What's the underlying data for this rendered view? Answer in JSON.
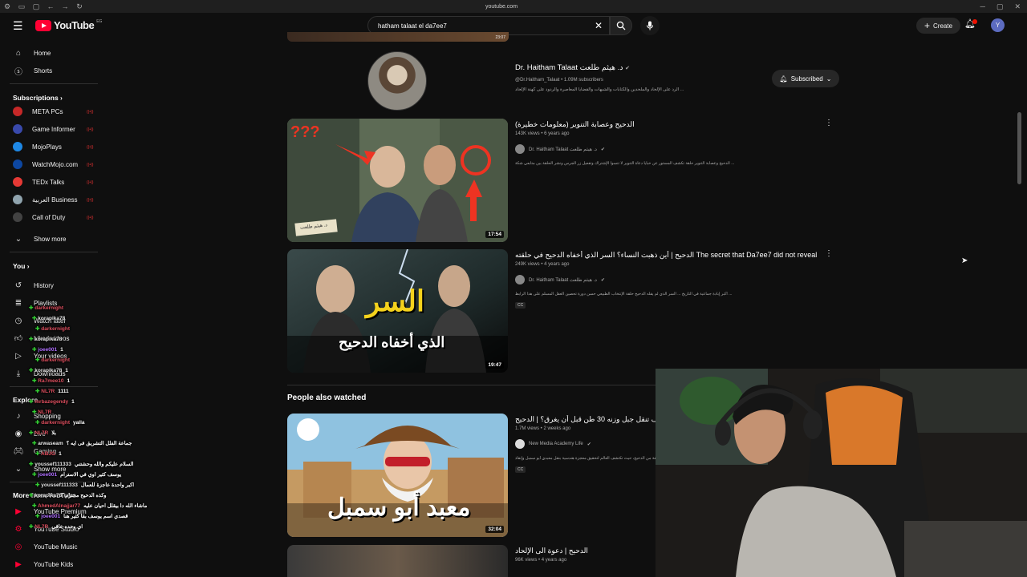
{
  "browser": {
    "url": "youtube.com"
  },
  "masthead": {
    "logo_text": "YouTube",
    "region": "EG",
    "search_query": "hatham talaat el da7ee7",
    "create_label": "Create",
    "avatar_letter": "Y",
    "bell_badge": "9+"
  },
  "sidebar": {
    "home": "Home",
    "shorts": "Shorts",
    "subscriptions_header": "Subscriptions",
    "subscriptions": [
      {
        "label": "META PCs",
        "color": "#c62828"
      },
      {
        "label": "Game Informer",
        "color": "#3949ab"
      },
      {
        "label": "MojoPlays",
        "color": "#1e88e5"
      },
      {
        "label": "WatchMojo.com",
        "color": "#0d47a1"
      },
      {
        "label": "TEDx Talks",
        "color": "#e53935"
      },
      {
        "label": "العربية Business",
        "color": "#90a4ae"
      },
      {
        "label": "Call of Duty",
        "color": "#424242"
      }
    ],
    "show_more": "Show more",
    "you_header": "You",
    "you_items": [
      "History",
      "Playlists",
      "Watch later",
      "Liked videos",
      "Your videos",
      "Downloads"
    ],
    "explore_header": "Explore",
    "explore_items": [
      "Shopping",
      "Live",
      "Gaming"
    ],
    "show_more_2": "Show more",
    "more_header": "More from YouTube",
    "more_items": [
      "YouTube Premium",
      "YouTube Studio",
      "YouTube Music",
      "YouTube Kids"
    ]
  },
  "chat": [
    {
      "user": "darkernight",
      "text": "",
      "color": "#e05060"
    },
    {
      "user": "korapika78",
      "text": "",
      "color": "#e8e8e8"
    },
    {
      "user": "darkernight",
      "text": "",
      "color": "#e05060"
    },
    {
      "user": "korapika78",
      "text": "",
      "color": "#e8e8e8"
    },
    {
      "user": "joee001",
      "text": "1",
      "color": "#b070ff"
    },
    {
      "user": "darkernight",
      "text": "",
      "color": "#e05060"
    },
    {
      "user": "korapika78",
      "text": "1",
      "color": "#e8e8e8"
    },
    {
      "user": "Ra7mee10",
      "text": "1",
      "color": "#e05060"
    },
    {
      "user": "NL7R",
      "text": "1111",
      "color": "#e05060"
    },
    {
      "user": "mrbazegendy",
      "text": "1",
      "color": "#e05060"
    },
    {
      "user": "NL7R",
      "text": "",
      "color": "#e05060"
    },
    {
      "user": "darkernight",
      "text": "yalla",
      "color": "#e05060"
    },
    {
      "user": "NL7R",
      "text": "بلا",
      "color": "#e05060"
    },
    {
      "user": "arwaseam",
      "text": "جماعة الفلل التشريق فى ايه ؟",
      "color": "#e8e8e8"
    },
    {
      "user": "ABJG",
      "text": "1",
      "color": "#e05060"
    },
    {
      "user": "youssef111333",
      "text": "السلام عليكم والله وحشتني",
      "color": "#e8e8e8"
    },
    {
      "user": "joee001",
      "text": "يوسف كثير اوي في الاسترام",
      "color": "#b070ff"
    },
    {
      "user": "youssef111333",
      "text": "اكبر واحدة عاجزة للعمال",
      "color": "#e8e8e8"
    },
    {
      "user": "korapika78",
      "text": "وكذه الدحيح محترم",
      "color": "#e8e8e8"
    },
    {
      "user": "AhmedAlnajjar77",
      "text": "ماشاء الله دا بيقلل احيان عليه",
      "color": "#e05060"
    },
    {
      "user": "joee001",
      "text": "قصدي اسم يوسف بقا كثير هنا",
      "color": "#b070ff"
    },
    {
      "user": "NL7R",
      "text": "اي وحده عاقي",
      "color": "#e05060"
    }
  ],
  "top_video": {
    "duration": "23:07"
  },
  "channel": {
    "name": "Dr. Haitham Talaat د. هيثم طلعت",
    "handle": "@Dr.Haitham_Talaat",
    "subscribers": "1.09M subscribers",
    "description": "الرد على الإلحاد والملحدين والكتابات والشبهات والقضايا المعاصرة والردود على كهنة الإلحاد ...",
    "subscribe_label": "Subscribed"
  },
  "videos": [
    {
      "title": "الدحيح وعصابة التنوير (معلومات خطيرة)",
      "views": "143K views",
      "age": "6 years ago",
      "channel": "Dr. Haitham Talaat د. هيثم طلعت",
      "description": "الدحيح وعصابة التنوير حلقة تكشف المستور عن خبايا دعاة التنوير لا تنسوا الإشتراك وتفعيل زر الجرس ونشر الحلقة بين متابعي شكة ...",
      "duration": "17:54",
      "cc": ""
    },
    {
      "title": "الدحيح | أين ذهبت النساء؟ السر الذي أخفاه الدحيح في حلقته The secret that Da7ee7 did not reveal",
      "views": "249K views",
      "age": "4 years ago",
      "channel": "Dr. Haitham Talaat د. هيثم طلعت",
      "description": "أكبر إبادة جماعية في التاريخ ... السر الذي لم يقله الدحيح حلقة الإنتخاب الطبيعي حسن دورة تحصين العقل المسلم على هذا الرابط ...",
      "duration": "19:47",
      "cc": "CC"
    }
  ],
  "section": {
    "title": "People also watched"
  },
  "also_watched": [
    {
      "title": "كيف تنقل جبل وزنه 30 طن قبل أن يغرق؟ | الدحيح",
      "views": "1.7M views",
      "age": "2 weeks ago",
      "channel": "New Media Academy Life",
      "description": "في هذه الحلقة من الدحيح، حيث تكتشف العالم لتحقيق معجزة هندسية بنقل معبدي أبو سمبل وإنقاذ ...",
      "duration": "32:04",
      "cc": "CC"
    },
    {
      "title": "الدحيح | دعوة الى الإلحاد",
      "views": "96K views",
      "age": "4 years ago",
      "channel": "",
      "description": "",
      "duration": "",
      "cc": ""
    }
  ],
  "thumb_text": {
    "v1_sign": "د. هيثم طلعت",
    "v1_q": "???",
    "v2_big": "السر",
    "v2_sub": "الذي أخفاه الدحيح",
    "v3_big": "معبد أبو سمبل"
  }
}
